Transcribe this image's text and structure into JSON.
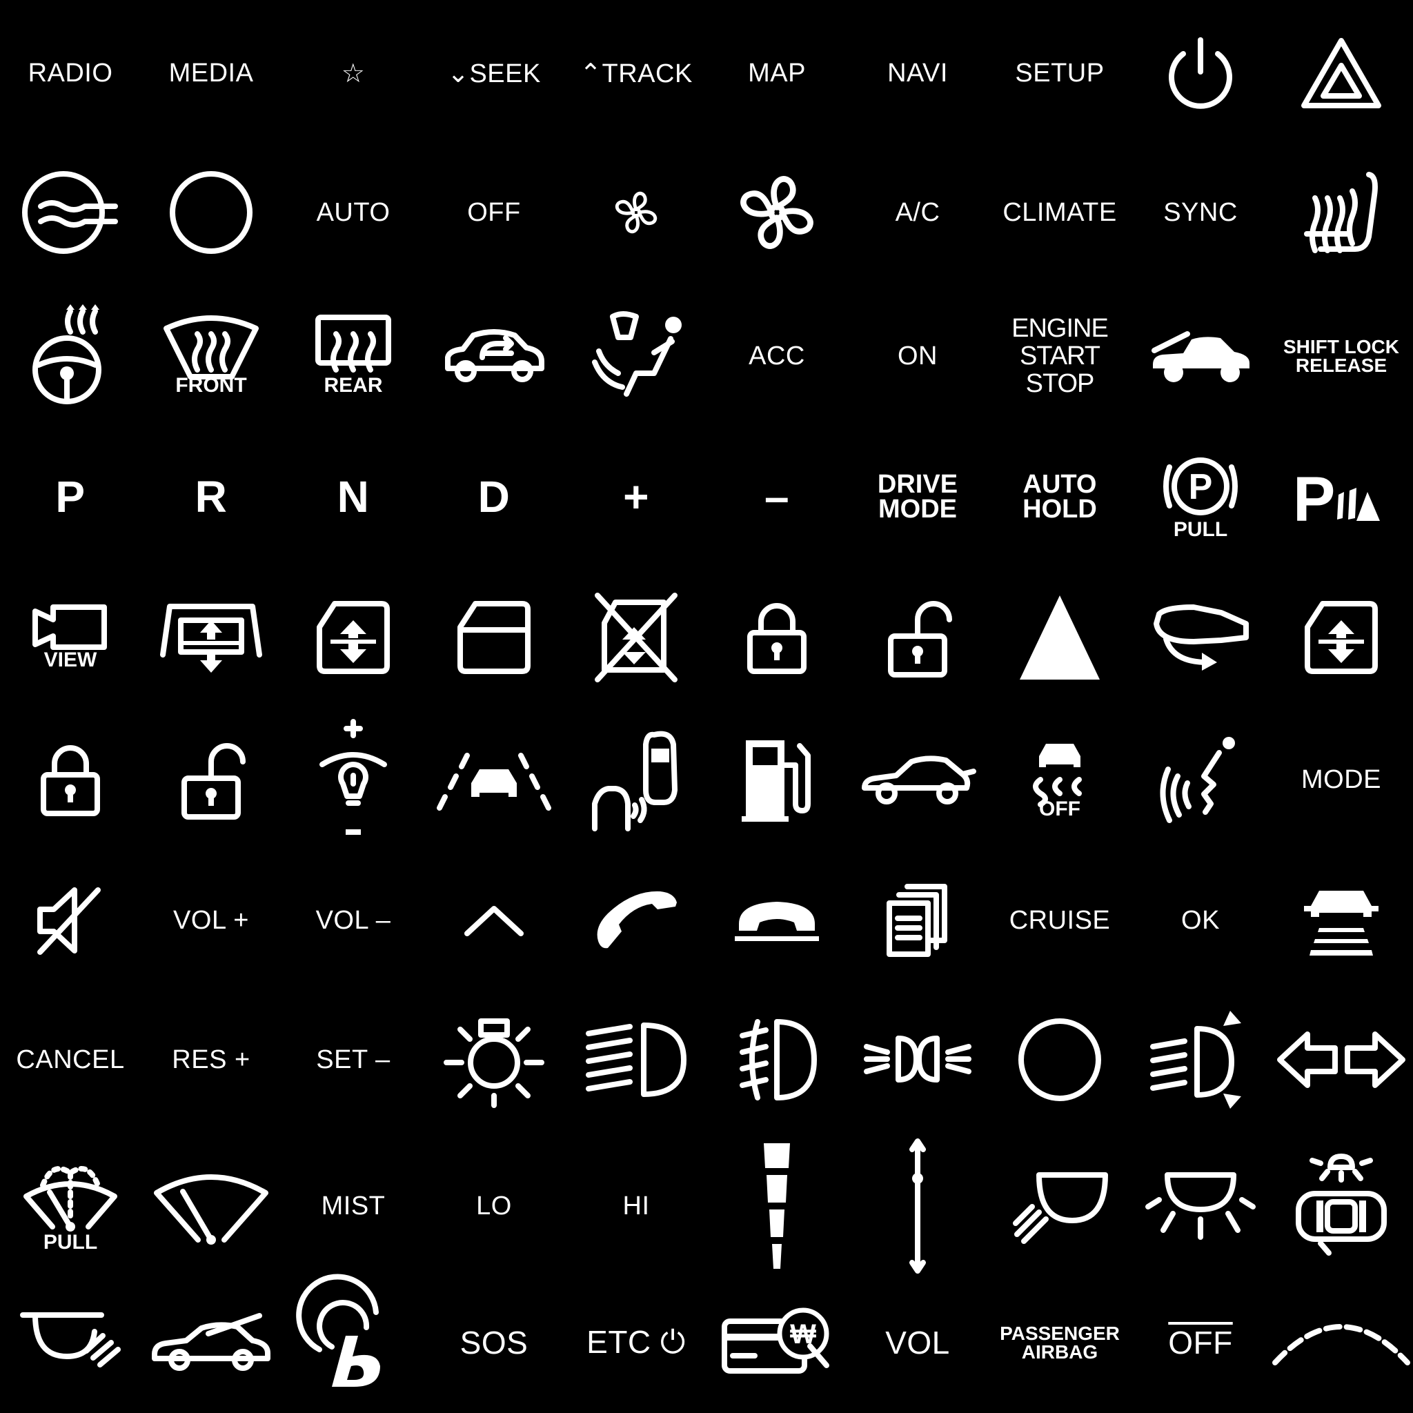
{
  "rows": [
    [
      {
        "label": "RADIO"
      },
      {
        "label": "MEDIA"
      },
      {
        "label": "☆"
      },
      {
        "label": "⌄SEEK"
      },
      {
        "label": "⌃TRACK"
      },
      {
        "label": "MAP"
      },
      {
        "label": "NAVI"
      },
      {
        "label": "SETUP"
      },
      {
        "icon": "power-icon"
      },
      {
        "icon": "hazard-icon"
      }
    ],
    [
      {
        "icon": "defrost-circle-icon"
      },
      {
        "icon": "circle-icon"
      },
      {
        "label": "AUTO"
      },
      {
        "label": "OFF"
      },
      {
        "icon": "fan-small-icon"
      },
      {
        "icon": "fan-large-icon"
      },
      {
        "label": "A/C"
      },
      {
        "label": "CLIMATE"
      },
      {
        "label": "SYNC"
      },
      {
        "icon": "heated-seat-icon"
      }
    ],
    [
      {
        "icon": "heated-steering-icon"
      },
      {
        "icon": "front-defrost-icon",
        "caption": "FRONT"
      },
      {
        "icon": "rear-defrost-icon",
        "caption": "REAR"
      },
      {
        "icon": "recirculation-icon"
      },
      {
        "icon": "air-to-face-icon"
      },
      {
        "label": "ACC"
      },
      {
        "label": "ON"
      },
      {
        "label": "ENGINE\nSTART\nSTOP"
      },
      {
        "icon": "hood-open-icon"
      },
      {
        "label": "SHIFT LOCK\nRELEASE"
      }
    ],
    [
      {
        "label": "P"
      },
      {
        "label": "R"
      },
      {
        "label": "N"
      },
      {
        "label": "D"
      },
      {
        "label": "+"
      },
      {
        "label": "–"
      },
      {
        "label": "DRIVE\nMODE"
      },
      {
        "label": "AUTO\nHOLD"
      },
      {
        "icon": "parking-brake-icon",
        "caption": "PULL"
      },
      {
        "icon": "parking-sensor-icon"
      }
    ],
    [
      {
        "icon": "camera-icon",
        "caption": "VIEW"
      },
      {
        "icon": "window-up-down-icon"
      },
      {
        "icon": "window-switch-icon"
      },
      {
        "icon": "window-icon"
      },
      {
        "icon": "window-lock-icon"
      },
      {
        "icon": "lock-icon"
      },
      {
        "icon": "unlock-icon"
      },
      {
        "icon": "triangle-icon"
      },
      {
        "icon": "mirror-fold-icon"
      },
      {
        "icon": "window-switch-icon"
      }
    ],
    [
      {
        "icon": "lock-icon"
      },
      {
        "icon": "unlock-icon"
      },
      {
        "icon": "dimmer-icon"
      },
      {
        "icon": "lane-assist-icon"
      },
      {
        "icon": "blind-spot-icon"
      },
      {
        "icon": "fuel-icon"
      },
      {
        "icon": "trunk-open-icon"
      },
      {
        "icon": "traction-off-icon",
        "caption": "OFF"
      },
      {
        "icon": "voice-command-icon"
      },
      {
        "label": "MODE"
      }
    ],
    [
      {
        "icon": "mute-icon"
      },
      {
        "label": "VOL +"
      },
      {
        "label": "VOL –"
      },
      {
        "icon": "chevron-up-icon"
      },
      {
        "icon": "phone-answer-icon"
      },
      {
        "icon": "phone-hangup-icon"
      },
      {
        "icon": "documents-icon"
      },
      {
        "label": "CRUISE"
      },
      {
        "label": "OK"
      },
      {
        "icon": "lane-keep-icon"
      }
    ],
    [
      {
        "label": "CANCEL"
      },
      {
        "label": "RES +"
      },
      {
        "label": "SET –"
      },
      {
        "icon": "parking-light-icon"
      },
      {
        "icon": "high-beam-icon"
      },
      {
        "icon": "fog-light-icon"
      },
      {
        "icon": "side-lights-icon"
      },
      {
        "icon": "circle-icon"
      },
      {
        "icon": "headlight-level-icon"
      },
      {
        "icon": "turn-signal-icon"
      }
    ],
    [
      {
        "icon": "washer-icon",
        "caption": "PULL"
      },
      {
        "icon": "wiper-icon"
      },
      {
        "label": "MIST"
      },
      {
        "label": "LO"
      },
      {
        "label": "HI"
      },
      {
        "icon": "intermittent-icon"
      },
      {
        "icon": "adjust-arrow-icon"
      },
      {
        "icon": "dome-light-icon"
      },
      {
        "icon": "room-light-icon"
      },
      {
        "icon": "interior-light-icon"
      }
    ],
    [
      {
        "icon": "map-light-icon"
      },
      {
        "icon": "antenna-car-icon"
      },
      {
        "icon": "bluelink-icon"
      },
      {
        "label": "SOS"
      },
      {
        "label": "ETC ⏻"
      },
      {
        "icon": "card-payment-icon"
      },
      {
        "label": "VOL"
      },
      {
        "label": "PASSENGER\nAIRBAG"
      },
      {
        "label": "OFF"
      },
      {
        "icon": "dashed-arc-icon"
      }
    ]
  ]
}
